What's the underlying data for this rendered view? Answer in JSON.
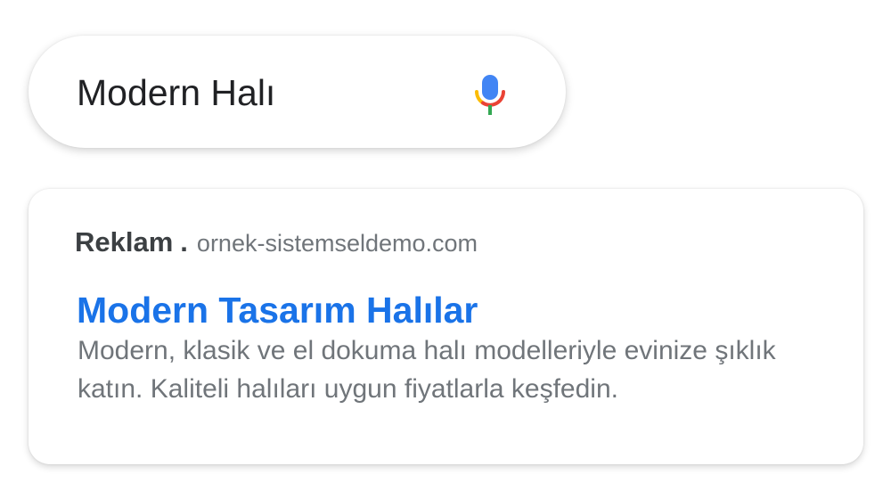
{
  "search": {
    "query": "Modern Halı",
    "mic_icon": "microphone-icon",
    "mic_colors": {
      "blue": "#4285F4",
      "red": "#EA4335",
      "yellow": "#FBBC05",
      "green": "#34A853"
    }
  },
  "ad": {
    "label": "Reklam",
    "separator": ".",
    "url": "ornek-sistemseldemo.com",
    "title": "Modern Tasarım Halılar",
    "description": "Modern, klasik ve el dokuma halı modelleriyle evinize şıklık katın. Kaliteli halıları uygun fiyatlarla keşfedin.",
    "colors": {
      "title": "#1a73e8",
      "label": "#3c4043",
      "muted": "#70757a"
    }
  }
}
